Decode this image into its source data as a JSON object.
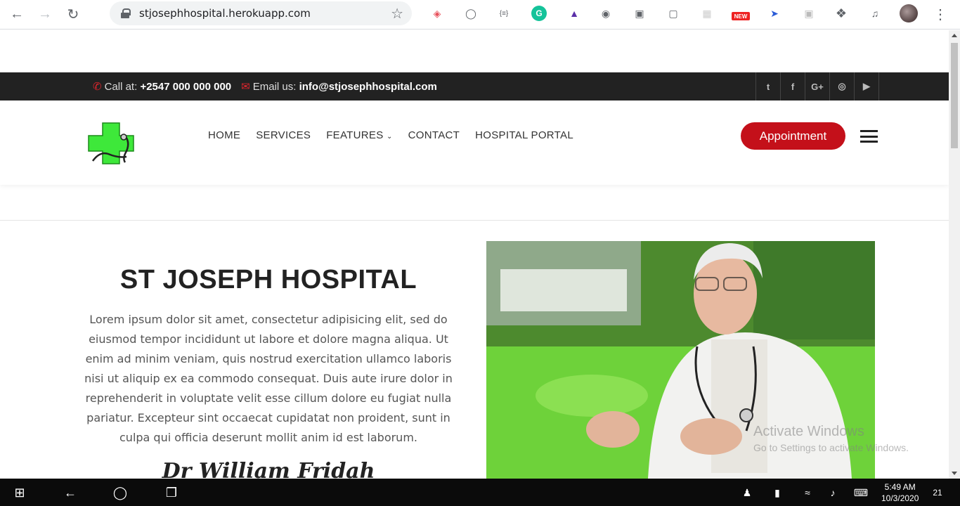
{
  "browser": {
    "url": "stjosephhospital.herokuapp.com"
  },
  "topbar": {
    "call_label": "Call at:",
    "phone": "+2547 000 000 000",
    "email_label": "Email us:",
    "email": "info@stjosephhospital.com",
    "socials": [
      "t",
      "f",
      "G+",
      "◎",
      "▶"
    ]
  },
  "nav": {
    "items": [
      "HOME",
      "SERVICES",
      "FEATURES",
      "CONTACT",
      "HOSPITAL PORTAL"
    ],
    "appointment_label": "Appointment"
  },
  "hero": {
    "title": "ST JOSEPH HOSPITAL",
    "text": "Lorem ipsum dolor sit amet, consectetur adipisicing elit, sed do eiusmod tempor incididunt ut labore et dolore magna aliqua. Ut enim ad minim veniam, quis nostrud exercitation ullamco laboris nisi ut aliquip ex ea commodo consequat. Duis aute irure dolor in reprehenderit in voluptate velit esse cillum dolore eu fugiat nulla pariatur. Excepteur sint occaecat cupidatat non proident, sunt in culpa qui officia deserunt mollit anim id est laborum.",
    "signature": "Dr William Fridah"
  },
  "watermark": {
    "line1": "Activate Windows",
    "line2": "Go to Settings to activate Windows."
  },
  "taskbar": {
    "time": "5:49 AM",
    "date": "10/3/2020",
    "notifications": "21"
  },
  "colors": {
    "accent_red": "#c4101a",
    "topbar_bg": "#222222",
    "logo_green": "#2ecc40"
  }
}
